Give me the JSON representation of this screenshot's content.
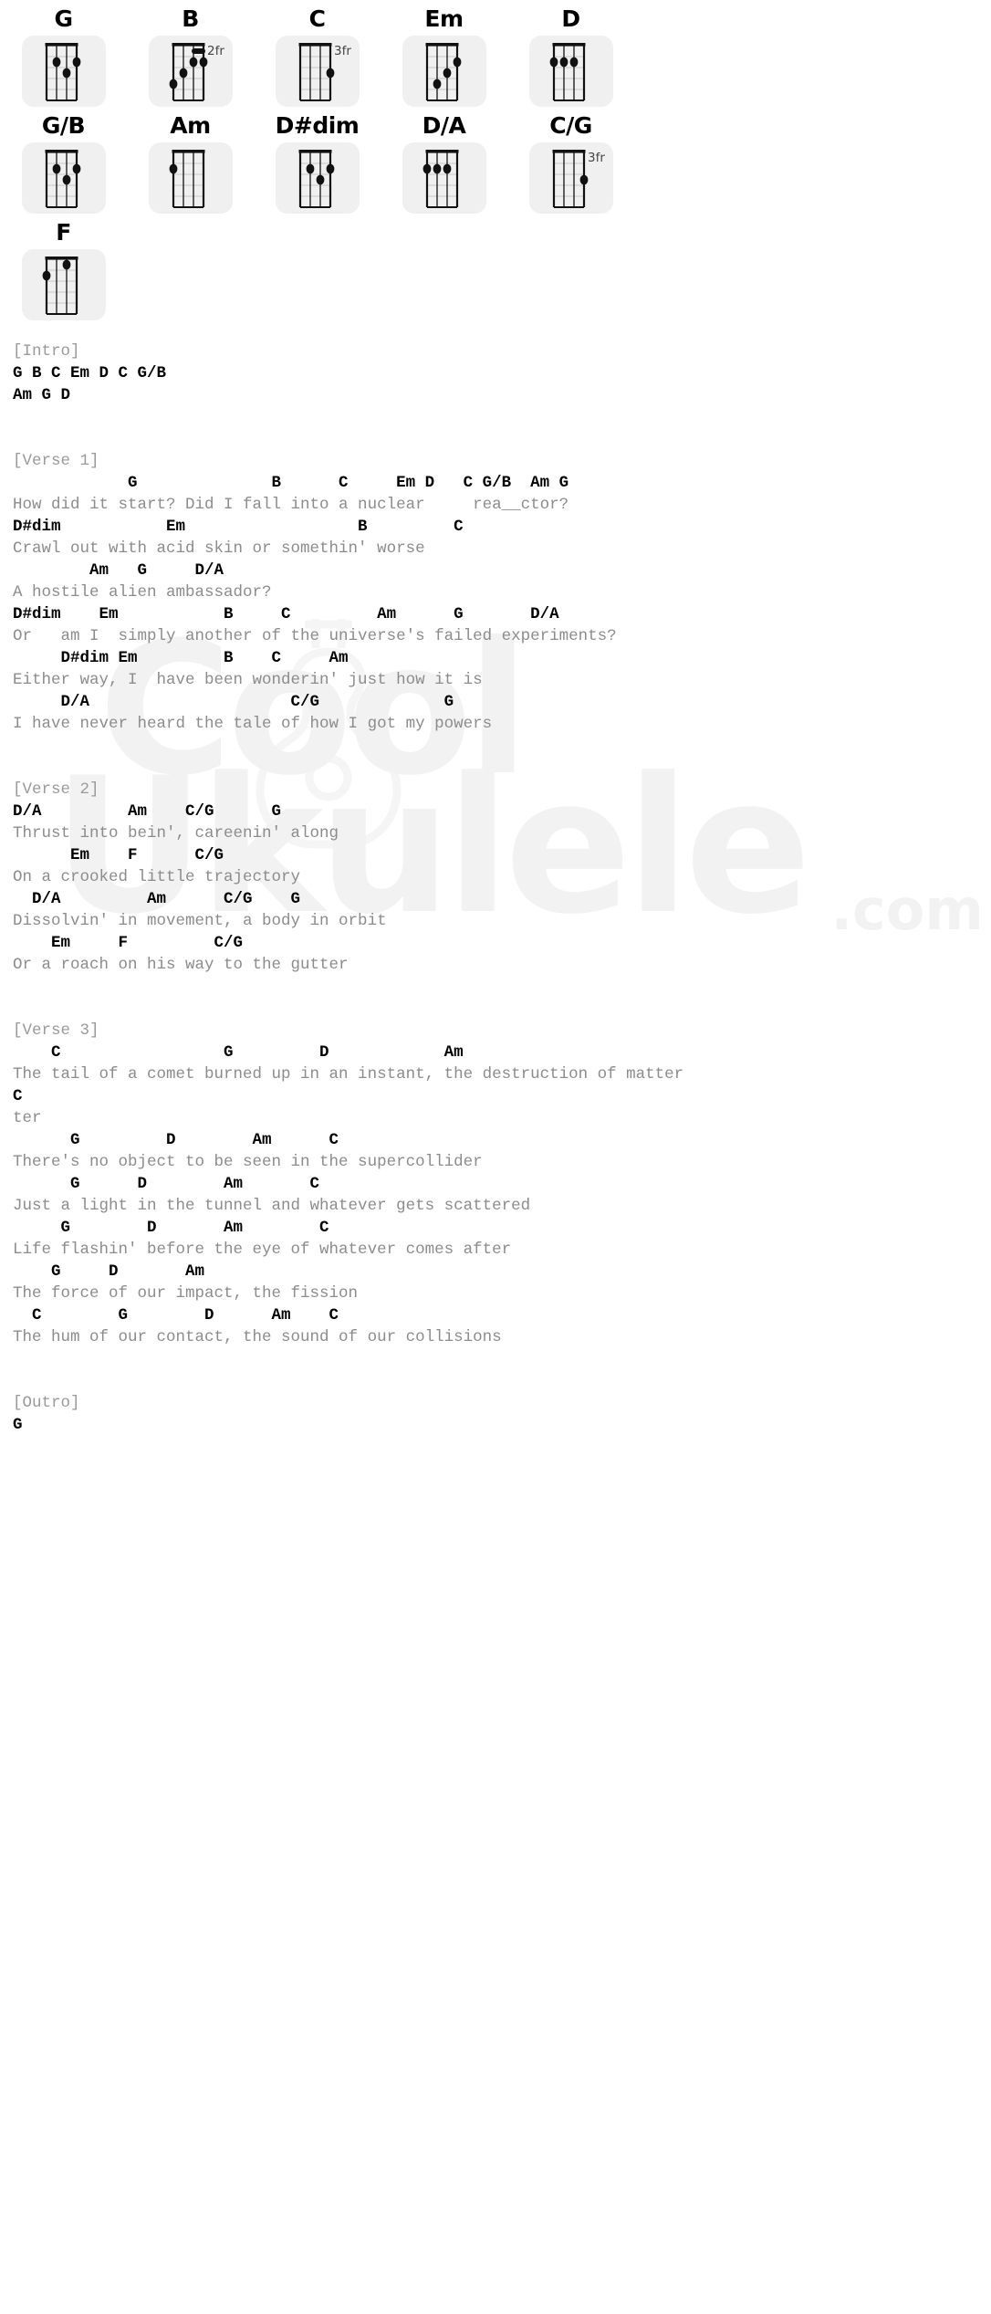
{
  "watermark": {
    "line1": "Cool",
    "line2": "Ukulele",
    "suffix": ".com",
    "uke_icon": "ukulele-icon"
  },
  "chord_diagrams": {
    "rows": [
      [
        {
          "name": "G",
          "frets": [
            0,
            2,
            3,
            2
          ],
          "base_fret": 1,
          "position_label": ""
        },
        {
          "name": "B",
          "frets": [
            4,
            3,
            2,
            2
          ],
          "base_fret": 1,
          "position_label": "2fr",
          "barre": {
            "from_string": 3,
            "to_string": 4,
            "fret": 1
          }
        },
        {
          "name": "C",
          "frets": [
            0,
            0,
            0,
            3
          ],
          "base_fret": 1,
          "position_label": "3fr"
        },
        {
          "name": "Em",
          "frets": [
            0,
            4,
            3,
            2
          ],
          "base_fret": 1,
          "position_label": ""
        },
        {
          "name": "D",
          "frets": [
            2,
            2,
            2,
            0
          ],
          "base_fret": 1,
          "position_label": ""
        }
      ],
      [
        {
          "name": "G/B",
          "frets": [
            0,
            2,
            3,
            2
          ],
          "base_fret": 1,
          "position_label": ""
        },
        {
          "name": "Am",
          "frets": [
            2,
            0,
            0,
            0
          ],
          "base_fret": 1,
          "position_label": ""
        },
        {
          "name": "D#dim",
          "frets": [
            0,
            2,
            3,
            2
          ],
          "base_fret": 1,
          "position_label": ""
        },
        {
          "name": "D/A",
          "frets": [
            2,
            2,
            2,
            0
          ],
          "base_fret": 1,
          "position_label": ""
        },
        {
          "name": "C/G",
          "frets": [
            0,
            0,
            0,
            3
          ],
          "base_fret": 1,
          "position_label": "3fr"
        }
      ],
      [
        {
          "name": "F",
          "frets": [
            2,
            0,
            1,
            0
          ],
          "base_fret": 1,
          "position_label": ""
        }
      ]
    ]
  },
  "song": {
    "sections": [
      {
        "label": "[Intro]",
        "lines": [
          {
            "type": "chord",
            "text": "G B C Em D C G/B"
          },
          {
            "type": "chord",
            "text": "Am G D"
          }
        ]
      },
      {
        "label": "[Verse 1]",
        "lines": [
          {
            "type": "chord",
            "text": "            G              B      C     Em D   C G/B  Am G"
          },
          {
            "type": "lyric",
            "text": "How did it start? Did I fall into a nuclear     rea__ctor?"
          },
          {
            "type": "chord",
            "text": "D#dim           Em                  B         C"
          },
          {
            "type": "lyric",
            "text": "Crawl out with acid skin or somethin' worse"
          },
          {
            "type": "chord",
            "text": "        Am   G     D/A"
          },
          {
            "type": "lyric",
            "text": "A hostile alien ambassador?"
          },
          {
            "type": "chord",
            "text": "D#dim    Em           B     C         Am      G       D/A"
          },
          {
            "type": "lyric",
            "text": "Or   am I  simply another of the universe's failed experiments?"
          },
          {
            "type": "chord",
            "text": "     D#dim Em         B    C     Am"
          },
          {
            "type": "lyric",
            "text": "Either way, I  have been wonderin' just how it is"
          },
          {
            "type": "chord",
            "text": "     D/A                     C/G             G"
          },
          {
            "type": "lyric",
            "text": "I have never heard the tale of how I got my powers"
          }
        ]
      },
      {
        "label": "[Verse 2]",
        "lines": [
          {
            "type": "chord",
            "text": "D/A         Am    C/G      G"
          },
          {
            "type": "lyric",
            "text": "Thrust into bein', careenin' along"
          },
          {
            "type": "chord",
            "text": "      Em    F      C/G"
          },
          {
            "type": "lyric",
            "text": "On a crooked little trajectory"
          },
          {
            "type": "chord",
            "text": "  D/A         Am      C/G    G"
          },
          {
            "type": "lyric",
            "text": "Dissolvin' in movement, a body in orbit"
          },
          {
            "type": "chord",
            "text": "    Em     F         C/G"
          },
          {
            "type": "lyric",
            "text": "Or a roach on his way to the gutter"
          }
        ]
      },
      {
        "label": "[Verse 3]",
        "lines": [
          {
            "type": "chord",
            "text": "    C                 G         D            Am"
          },
          {
            "type": "lyric",
            "text": "The tail of a comet burned up in an instant, the destruction of matter"
          },
          {
            "type": "chord",
            "text": "C"
          },
          {
            "type": "lyric",
            "text": "ter"
          },
          {
            "type": "chord",
            "text": "      G         D        Am      C"
          },
          {
            "type": "lyric",
            "text": "There's no object to be seen in the supercollider"
          },
          {
            "type": "chord",
            "text": "      G      D        Am       C"
          },
          {
            "type": "lyric",
            "text": "Just a light in the tunnel and whatever gets scattered"
          },
          {
            "type": "chord",
            "text": "     G        D       Am        C"
          },
          {
            "type": "lyric",
            "text": "Life flashin' before the eye of whatever comes after"
          },
          {
            "type": "chord",
            "text": "    G     D       Am"
          },
          {
            "type": "lyric",
            "text": "The force of our impact, the fission"
          },
          {
            "type": "chord",
            "text": "  C        G        D      Am    C"
          },
          {
            "type": "lyric",
            "text": "The hum of our contact, the sound of our collisions"
          }
        ]
      },
      {
        "label": "[Outro]",
        "lines": [
          {
            "type": "chord",
            "text": "G"
          }
        ]
      }
    ]
  }
}
